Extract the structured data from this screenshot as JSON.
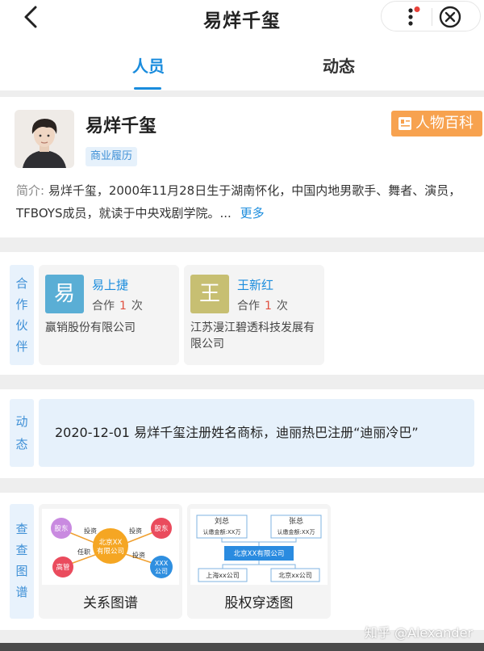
{
  "colors": {
    "accent": "#1a8cdd",
    "baike": "#f7a24f",
    "label_bg": "#e8f2fc",
    "count": "#e05040"
  },
  "header": {
    "title": "易烊千玺",
    "back_icon": "chevron-left-icon",
    "more_icon": "more-vertical-icon",
    "close_icon": "close-circle-icon"
  },
  "tabs": [
    {
      "label": "人员",
      "active": true
    },
    {
      "label": "动态",
      "active": false
    }
  ],
  "profile": {
    "name": "易烊千玺",
    "tag": "商业履历",
    "baike_label": "人物百科",
    "intro_label": "简介:",
    "intro_text": "易烊千玺，2000年11月28日生于湖南怀化，中国内地男歌手、舞者、演员，TFBOYS成员，就读于中央戏剧学院。...",
    "more_label": "更多"
  },
  "partners": {
    "label_chars": [
      "合",
      "作",
      "伙",
      "伴"
    ],
    "items": [
      {
        "avatar_char": "易",
        "name": "易上捷",
        "coop_prefix": "合作",
        "count": "1",
        "coop_suffix": "次",
        "company": "赢销股份有限公司"
      },
      {
        "avatar_char": "王",
        "name": "王新红",
        "coop_prefix": "合作",
        "count": "1",
        "coop_suffix": "次",
        "company": "江苏漫江碧透科技发展有限公司"
      }
    ]
  },
  "dynamics": {
    "label_chars": [
      "动",
      "态"
    ],
    "text": "2020-12-01 易烊千玺注册姓名商标，迪丽热巴注册“迪丽冷巴”"
  },
  "graphs": {
    "label_chars": [
      "查",
      "查",
      "图",
      "谱"
    ],
    "relation": {
      "label": "关系图谱",
      "center": "北京XX\n有限公司",
      "nodes": [
        "股东",
        "股东",
        "高管",
        "XXX\n公司"
      ],
      "edges": [
        "投资",
        "投资",
        "任职",
        "投资"
      ]
    },
    "equity": {
      "label": "股权穿透图",
      "top_nodes": [
        {
          "name": "刘总",
          "sub": "认缴金额:XX万"
        },
        {
          "name": "张总",
          "sub": "认缴金额:XX万"
        }
      ],
      "center": "北京XX有限公司",
      "bottom_nodes": [
        "上海xx公司",
        "北京xx公司"
      ]
    }
  },
  "watermark": "知乎 @Alexander"
}
